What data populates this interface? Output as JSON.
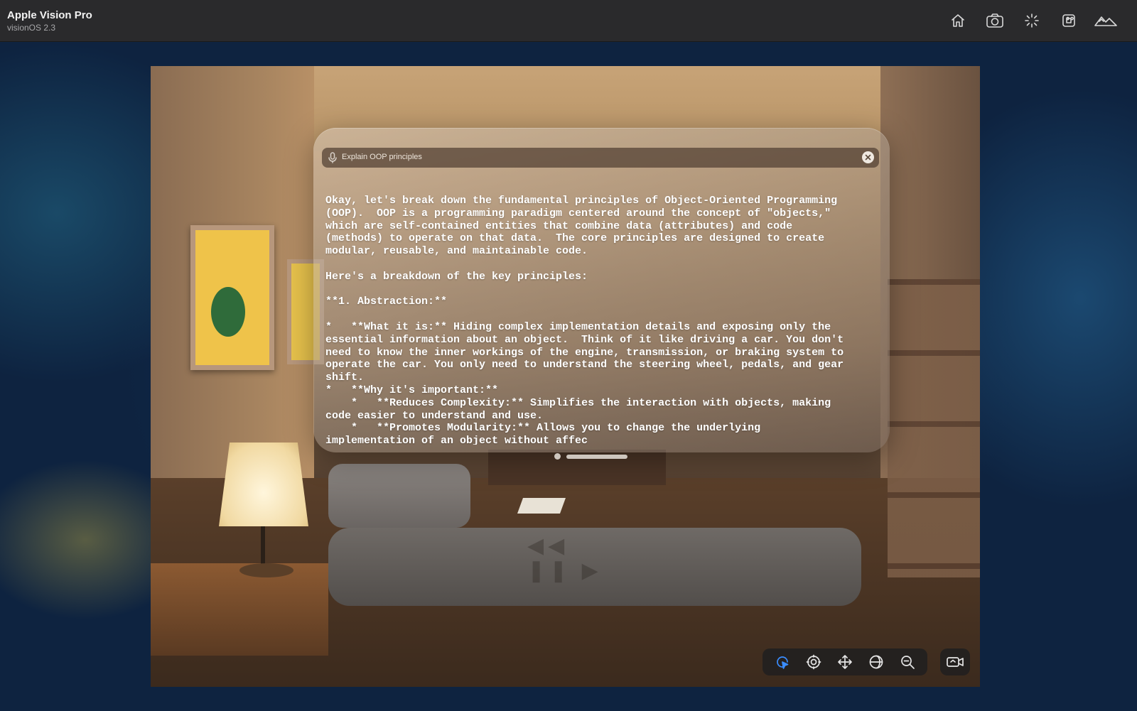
{
  "titlebar": {
    "app_name": "Apple Vision Pro",
    "os_version": "visionOS 2.3",
    "icons": [
      "home-icon",
      "screenshot-icon",
      "immersion-icon",
      "command-icon",
      "environment-icon"
    ]
  },
  "window": {
    "prompt": "Explain OOP principles",
    "response": "Okay, let's break down the fundamental principles of Object-Oriented Programming\n(OOP).  OOP is a programming paradigm centered around the concept of \"objects,\"\nwhich are self-contained entities that combine data (attributes) and code\n(methods) to operate on that data.  The core principles are designed to create\nmodular, reusable, and maintainable code.\n\nHere's a breakdown of the key principles:\n\n**1. Abstraction:**\n\n*   **What it is:** Hiding complex implementation details and exposing only the\nessential information about an object.  Think of it like driving a car. You don't\nneed to know the inner workings of the engine, transmission, or braking system to\noperate the car. You only need to understand the steering wheel, pedals, and gear\nshift.\n*   **Why it's important:**\n    *   **Reduces Complexity:** Simplifies the interaction with objects, making\ncode easier to understand and use.\n    *   **Promotes Modularity:** Allows you to change the underlying\nimplementation of an object without affec"
  },
  "toolbar": {
    "tools": [
      "interact-icon",
      "look-icon",
      "pan-icon",
      "orbit-icon",
      "zoom-icon"
    ],
    "active_tool": "interact-icon",
    "camera": "camera-icon",
    "accent_color": "#3a8dff"
  }
}
